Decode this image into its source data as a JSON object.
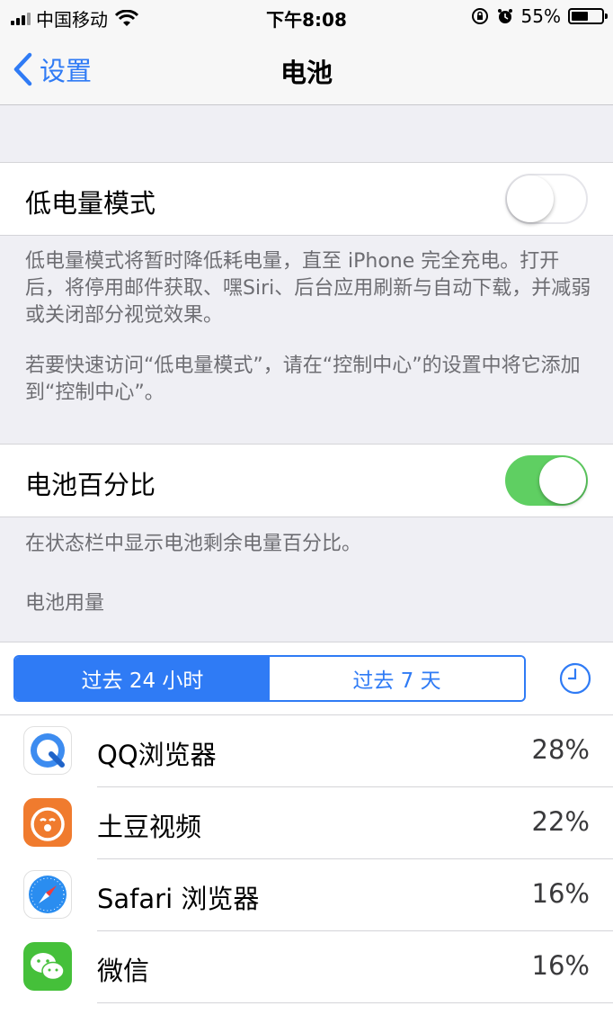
{
  "status_bar": {
    "carrier": "中国移动",
    "time": "下午8:08",
    "battery_pct": "55%",
    "battery_level": 0.55
  },
  "nav": {
    "back_label": "设置",
    "title": "电池"
  },
  "low_power": {
    "label": "低电量模式",
    "enabled": false,
    "note_1": "低电量模式将暂时降低耗电量，直至 iPhone 完全充电。打开后，将停用邮件获取、嘿Siri、后台应用刷新与自动下载，并减弱或关闭部分视觉效果。",
    "note_2": "若要快速访问“低电量模式”，请在“控制中心”的设置中将它添加到“控制中心”。"
  },
  "battery_percentage": {
    "label": "电池百分比",
    "enabled": true,
    "note": "在状态栏中显示电池剩余电量百分比。"
  },
  "usage": {
    "header": "电池用量",
    "segments": [
      "过去 24 小时",
      "过去 7 天"
    ],
    "selected_segment": 0,
    "apps": [
      {
        "name": "QQ浏览器",
        "percent": "28%",
        "icon": "qq-browser-icon"
      },
      {
        "name": "土豆视频",
        "percent": "22%",
        "icon": "tudou-video-icon"
      },
      {
        "name": "Safari 浏览器",
        "percent": "16%",
        "icon": "safari-icon"
      },
      {
        "name": "微信",
        "percent": "16%",
        "icon": "wechat-icon"
      }
    ]
  },
  "colors": {
    "accent": "#2f7bf5",
    "toggle_on": "#5fcf62",
    "background": "#efeff4"
  }
}
